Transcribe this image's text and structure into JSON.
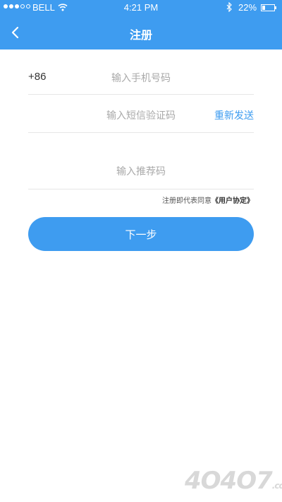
{
  "status_bar": {
    "carrier": "BELL",
    "time": "4:21 PM",
    "battery": "22%",
    "battery_level": 0.22,
    "icons": [
      "signal-dots",
      "wifi-icon",
      "bluetooth-icon",
      "battery-icon"
    ]
  },
  "nav": {
    "title": "注册",
    "back_icon": "chevron-left-icon"
  },
  "form": {
    "country_code": "+86",
    "phone_placeholder": "输入手机号码",
    "code_placeholder": "输入短信验证码",
    "resend_label": "重新发送",
    "referral_placeholder": "输入推荐码"
  },
  "agreement": {
    "prefix": "注册即代表同意",
    "link": "《用户协定》"
  },
  "next_button": "下一步",
  "watermark": {
    "text": "4O4O7",
    "suffix": ".com"
  },
  "colors": {
    "primary": "#3e9cf0",
    "background": "#ffffff",
    "divider": "#e6e6e6",
    "placeholder": "#a9a9a9"
  }
}
